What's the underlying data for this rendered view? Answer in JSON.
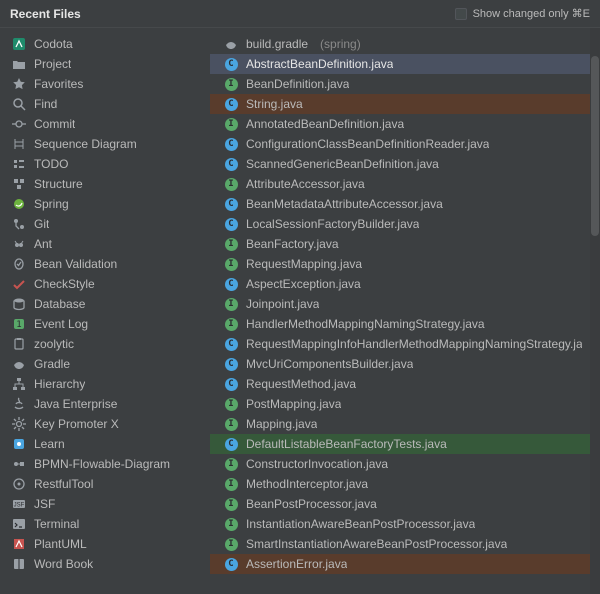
{
  "header": {
    "title": "Recent Files",
    "show_changed_label": "Show changed only ⌘E",
    "show_changed_checked": false
  },
  "sidebar": {
    "items": [
      {
        "label": "Codota",
        "icon": "codota-icon"
      },
      {
        "label": "Project",
        "icon": "folder-icon"
      },
      {
        "label": "Favorites",
        "icon": "star-icon"
      },
      {
        "label": "Find",
        "icon": "search-icon"
      },
      {
        "label": "Commit",
        "icon": "commit-icon"
      },
      {
        "label": "Sequence Diagram",
        "icon": "sequence-icon"
      },
      {
        "label": "TODO",
        "icon": "todo-icon"
      },
      {
        "label": "Structure",
        "icon": "structure-icon"
      },
      {
        "label": "Spring",
        "icon": "spring-icon"
      },
      {
        "label": "Git",
        "icon": "git-icon"
      },
      {
        "label": "Ant",
        "icon": "ant-icon"
      },
      {
        "label": "Bean Validation",
        "icon": "bean-validation-icon"
      },
      {
        "label": "CheckStyle",
        "icon": "checkstyle-icon"
      },
      {
        "label": "Database",
        "icon": "database-icon"
      },
      {
        "label": "Event Log",
        "icon": "event-log-icon"
      },
      {
        "label": "zoolytic",
        "icon": "clipboard-icon"
      },
      {
        "label": "Gradle",
        "icon": "gradle-icon"
      },
      {
        "label": "Hierarchy",
        "icon": "hierarchy-icon"
      },
      {
        "label": "Java Enterprise",
        "icon": "java-ee-icon"
      },
      {
        "label": "Key Promoter X",
        "icon": "gear-icon"
      },
      {
        "label": "Learn",
        "icon": "learn-icon"
      },
      {
        "label": "BPMN-Flowable-Diagram",
        "icon": "bpmn-icon"
      },
      {
        "label": "RestfulTool",
        "icon": "rest-icon"
      },
      {
        "label": "JSF",
        "icon": "jsf-icon"
      },
      {
        "label": "Terminal",
        "icon": "terminal-icon"
      },
      {
        "label": "PlantUML",
        "icon": "plantuml-icon"
      },
      {
        "label": "Word Book",
        "icon": "wordbook-icon"
      }
    ]
  },
  "files": [
    {
      "label": "build.gradle",
      "hint": "(spring)",
      "kind": "gradle",
      "highlight": "none"
    },
    {
      "label": "AbstractBeanDefinition.java",
      "kind": "class",
      "highlight": "selected"
    },
    {
      "label": "BeanDefinition.java",
      "kind": "interface",
      "highlight": "none"
    },
    {
      "label": "String.java",
      "kind": "class",
      "highlight": "brown"
    },
    {
      "label": "AnnotatedBeanDefinition.java",
      "kind": "interface",
      "highlight": "none"
    },
    {
      "label": "ConfigurationClassBeanDefinitionReader.java",
      "kind": "class",
      "highlight": "none"
    },
    {
      "label": "ScannedGenericBeanDefinition.java",
      "kind": "class",
      "highlight": "none"
    },
    {
      "label": "AttributeAccessor.java",
      "kind": "interface",
      "highlight": "none"
    },
    {
      "label": "BeanMetadataAttributeAccessor.java",
      "kind": "class",
      "highlight": "none"
    },
    {
      "label": "LocalSessionFactoryBuilder.java",
      "kind": "class",
      "highlight": "none"
    },
    {
      "label": "BeanFactory.java",
      "kind": "interface",
      "highlight": "none"
    },
    {
      "label": "RequestMapping.java",
      "kind": "interface",
      "highlight": "none"
    },
    {
      "label": "AspectException.java",
      "kind": "class",
      "highlight": "none"
    },
    {
      "label": "Joinpoint.java",
      "kind": "interface",
      "highlight": "none"
    },
    {
      "label": "HandlerMethodMappingNamingStrategy.java",
      "kind": "interface",
      "highlight": "none"
    },
    {
      "label": "RequestMappingInfoHandlerMethodMappingNamingStrategy.ja",
      "kind": "class",
      "highlight": "none"
    },
    {
      "label": "MvcUriComponentsBuilder.java",
      "kind": "class",
      "highlight": "none"
    },
    {
      "label": "RequestMethod.java",
      "kind": "class",
      "highlight": "none"
    },
    {
      "label": "PostMapping.java",
      "kind": "interface",
      "highlight": "none"
    },
    {
      "label": "Mapping.java",
      "kind": "interface",
      "highlight": "none"
    },
    {
      "label": "DefaultListableBeanFactoryTests.java",
      "kind": "class",
      "highlight": "green"
    },
    {
      "label": "ConstructorInvocation.java",
      "kind": "interface",
      "highlight": "none"
    },
    {
      "label": "MethodInterceptor.java",
      "kind": "interface",
      "highlight": "none"
    },
    {
      "label": "BeanPostProcessor.java",
      "kind": "interface",
      "highlight": "none"
    },
    {
      "label": "InstantiationAwareBeanPostProcessor.java",
      "kind": "interface",
      "highlight": "none"
    },
    {
      "label": "SmartInstantiationAwareBeanPostProcessor.java",
      "kind": "interface",
      "highlight": "none"
    },
    {
      "label": "AssertionError.java",
      "kind": "class",
      "highlight": "brown"
    }
  ]
}
